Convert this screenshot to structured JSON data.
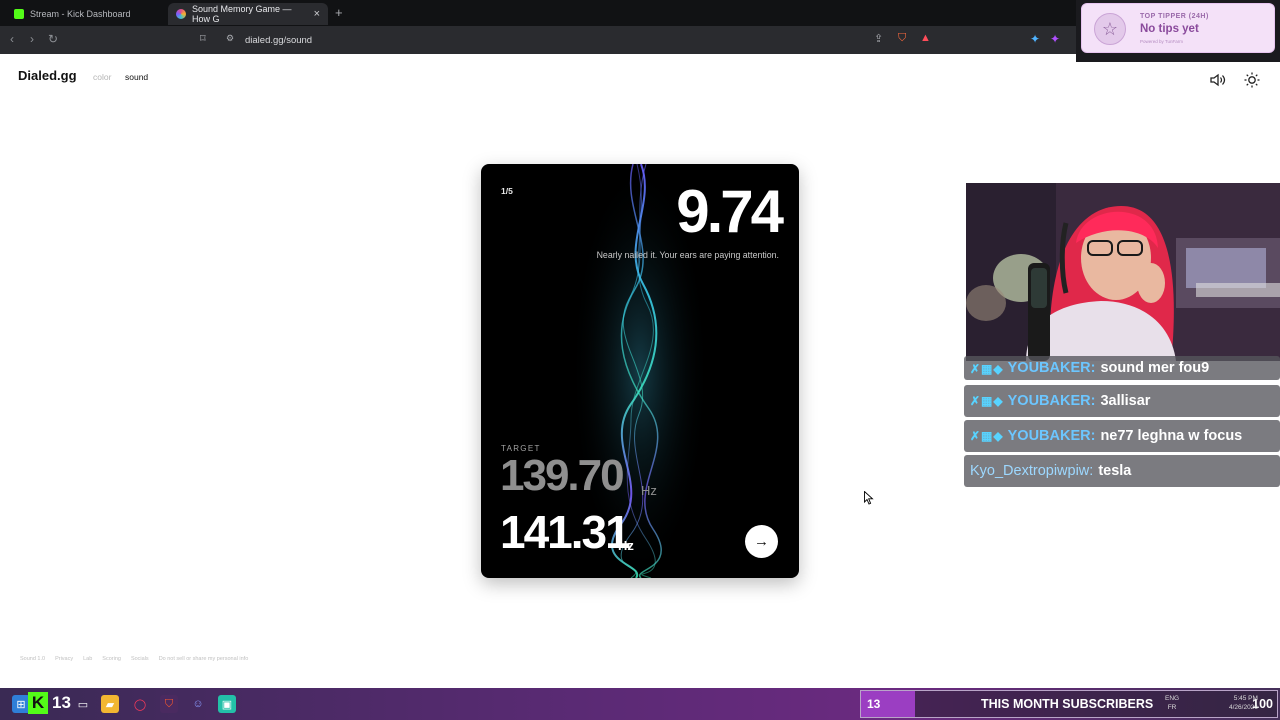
{
  "browser": {
    "tabs": [
      {
        "title": "Stream - Kick Dashboard",
        "fav_color": "#53fc18",
        "active": false
      },
      {
        "title": "Sound Memory Game — How G",
        "fav_color": "#e14d8b",
        "active": true
      }
    ],
    "new_tab": "+",
    "url": "dialed.gg/sound"
  },
  "tip_widget": {
    "title": "TOP TIPPER (24H)",
    "value": "No tips yet",
    "powered": "Powered by TunFarm"
  },
  "site": {
    "logo": "Dialed.gg",
    "nav": [
      {
        "label": "color",
        "active": false
      },
      {
        "label": "sound",
        "active": true
      }
    ]
  },
  "game": {
    "round": "1/5",
    "score": "9.74",
    "message": "Nearly nailed it. Your ears are paying attention.",
    "target_label": "TARGET",
    "target_value": "139.70",
    "target_unit": "Hz",
    "guess_value": "141.31",
    "guess_unit": "Hz",
    "next_icon": "arrow-right-icon"
  },
  "chat": [
    {
      "user": "YOUBAKER:",
      "message": "sound mer fou9",
      "badges": true
    },
    {
      "user": "YOUBAKER:",
      "message": "3allisar",
      "badges": true
    },
    {
      "user": "YOUBAKER:",
      "message": "ne77 leghna w focus",
      "badges": true
    },
    {
      "user": "Kyo_Dextropiwpiw:",
      "message": "tesla",
      "badges": false
    }
  ],
  "footer": [
    "Sound 1.0",
    "Privacy",
    "Lab",
    "Scoring",
    "Socials",
    "Do not sell or share my personal info"
  ],
  "taskbar": {
    "kick_count": "13",
    "subs_count": "13",
    "subs_label": "THIS MONTH SUBSCRIBERS",
    "subs_goal": "100",
    "subs_progress": 0.13,
    "lang_1": "ENG",
    "lang_2": "FR",
    "time": "5:45 PM",
    "date": "4/26/2026"
  },
  "colors": {
    "accent_kick": "#53fc18",
    "subs_bar": "#9b3ec2",
    "chat_username": "#6cc6ff"
  }
}
